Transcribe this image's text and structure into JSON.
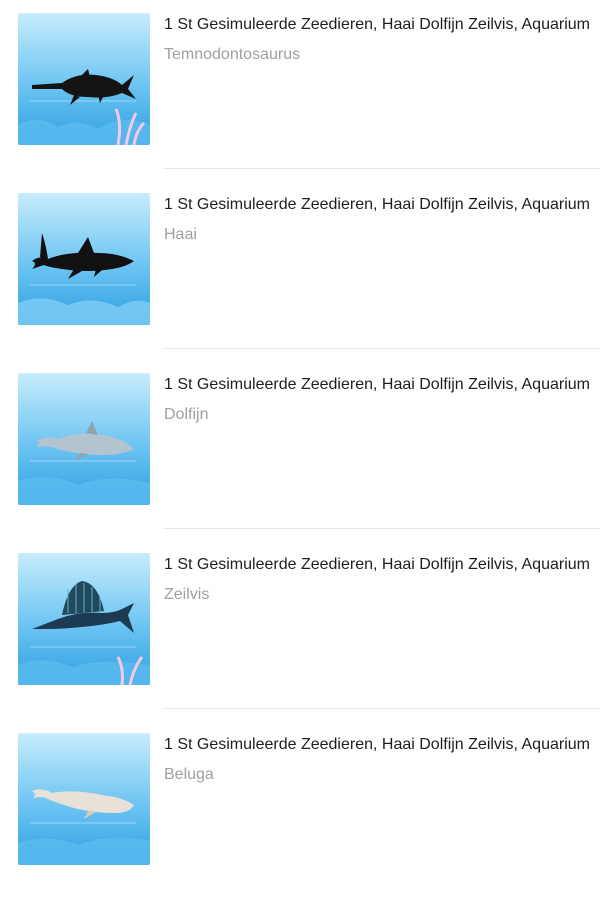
{
  "items": [
    {
      "title": "1 St Gesimuleerde Zeedieren, Haai Dolfijn Zeilvis, Aquarium",
      "variant": "Temnodontosaurus",
      "image_icon": "temnodontosaurus-figure-icon"
    },
    {
      "title": "1 St Gesimuleerde Zeedieren, Haai Dolfijn Zeilvis, Aquarium",
      "variant": "Haai",
      "image_icon": "shark-figure-icon"
    },
    {
      "title": "1 St Gesimuleerde Zeedieren, Haai Dolfijn Zeilvis, Aquarium",
      "variant": "Dolfijn",
      "image_icon": "dolphin-figure-icon"
    },
    {
      "title": "1 St Gesimuleerde Zeedieren, Haai Dolfijn Zeilvis, Aquarium",
      "variant": "Zeilvis",
      "image_icon": "sailfish-figure-icon"
    },
    {
      "title": "1 St Gesimuleerde Zeedieren, Haai Dolfijn Zeilvis, Aquarium",
      "variant": "Beluga",
      "image_icon": "beluga-figure-icon"
    }
  ],
  "colors": {
    "title_text": "#1f1f1f",
    "variant_text": "#a0a0a0",
    "divider": "#e6e6e6",
    "water_top": "#bfe6fb",
    "water_bottom": "#2a9fe0"
  }
}
